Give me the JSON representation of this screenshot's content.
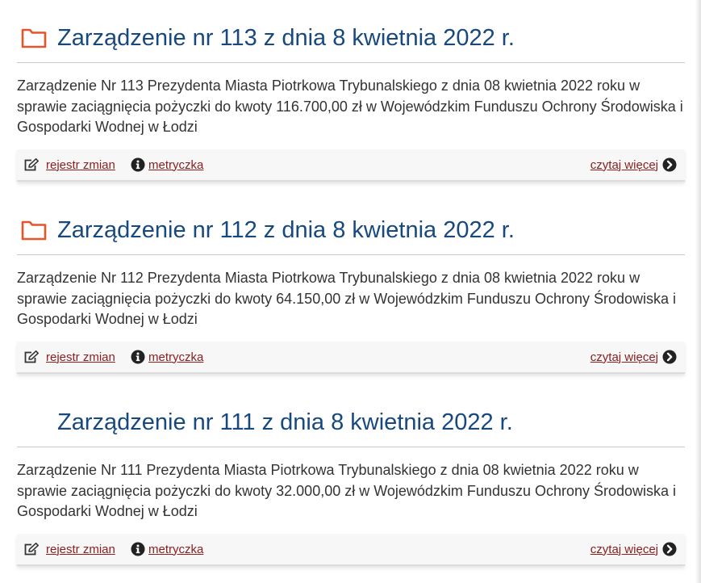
{
  "colors": {
    "title": "#17497f",
    "text": "#333333",
    "link": "#8b1d1d",
    "folder_icon": "#e4552b",
    "action_bar_bg": "#f7f7f7"
  },
  "entries": [
    {
      "title": "Zarządzenie nr 113 z dnia 8 kwietnia 2022 r.",
      "description": "Zarządzenie Nr 113 Prezydenta Miasta Piotrkowa Trybunalskiego z dnia 08 kwietnia 2022 roku w sprawie zaciągnięcia pożyczki do kwoty 116.700,00 zł w Wojewódzkim Funduszu Ochrony Środowiska i Gospodarki Wodnej w Łodzi",
      "icon": "folder-icon",
      "actions": {
        "rejestr": "rejestr zmian",
        "metryczka": "metryczka",
        "czytaj": "czytaj więcej"
      }
    },
    {
      "title": "Zarządzenie nr 112 z dnia 8 kwietnia 2022 r.",
      "description": "Zarządzenie Nr 112 Prezydenta Miasta Piotrkowa Trybunalskiego z dnia 08 kwietnia 2022 roku w sprawie zaciągnięcia pożyczki do kwoty 64.150,00 zł w Wojewódzkim Funduszu Ochrony Środowiska i Gospodarki Wodnej w Łodzi",
      "icon": "folder-icon",
      "actions": {
        "rejestr": "rejestr zmian",
        "metryczka": "metryczka",
        "czytaj": "czytaj więcej"
      }
    },
    {
      "title": "Zarządzenie nr 111 z dnia 8 kwietnia 2022 r.",
      "description": "Zarządzenie Nr 111 Prezydenta Miasta Piotrkowa Trybunalskiego z dnia 08 kwietnia 2022 roku w sprawie zaciągnięcia pożyczki do kwoty 32.000,00 zł w Wojewódzkim Funduszu Ochrony Środowiska i Gospodarki Wodnej w Łodzi",
      "icon": "none",
      "actions": {
        "rejestr": "rejestr zmian",
        "metryczka": "metryczka",
        "czytaj": "czytaj więcej"
      }
    }
  ]
}
